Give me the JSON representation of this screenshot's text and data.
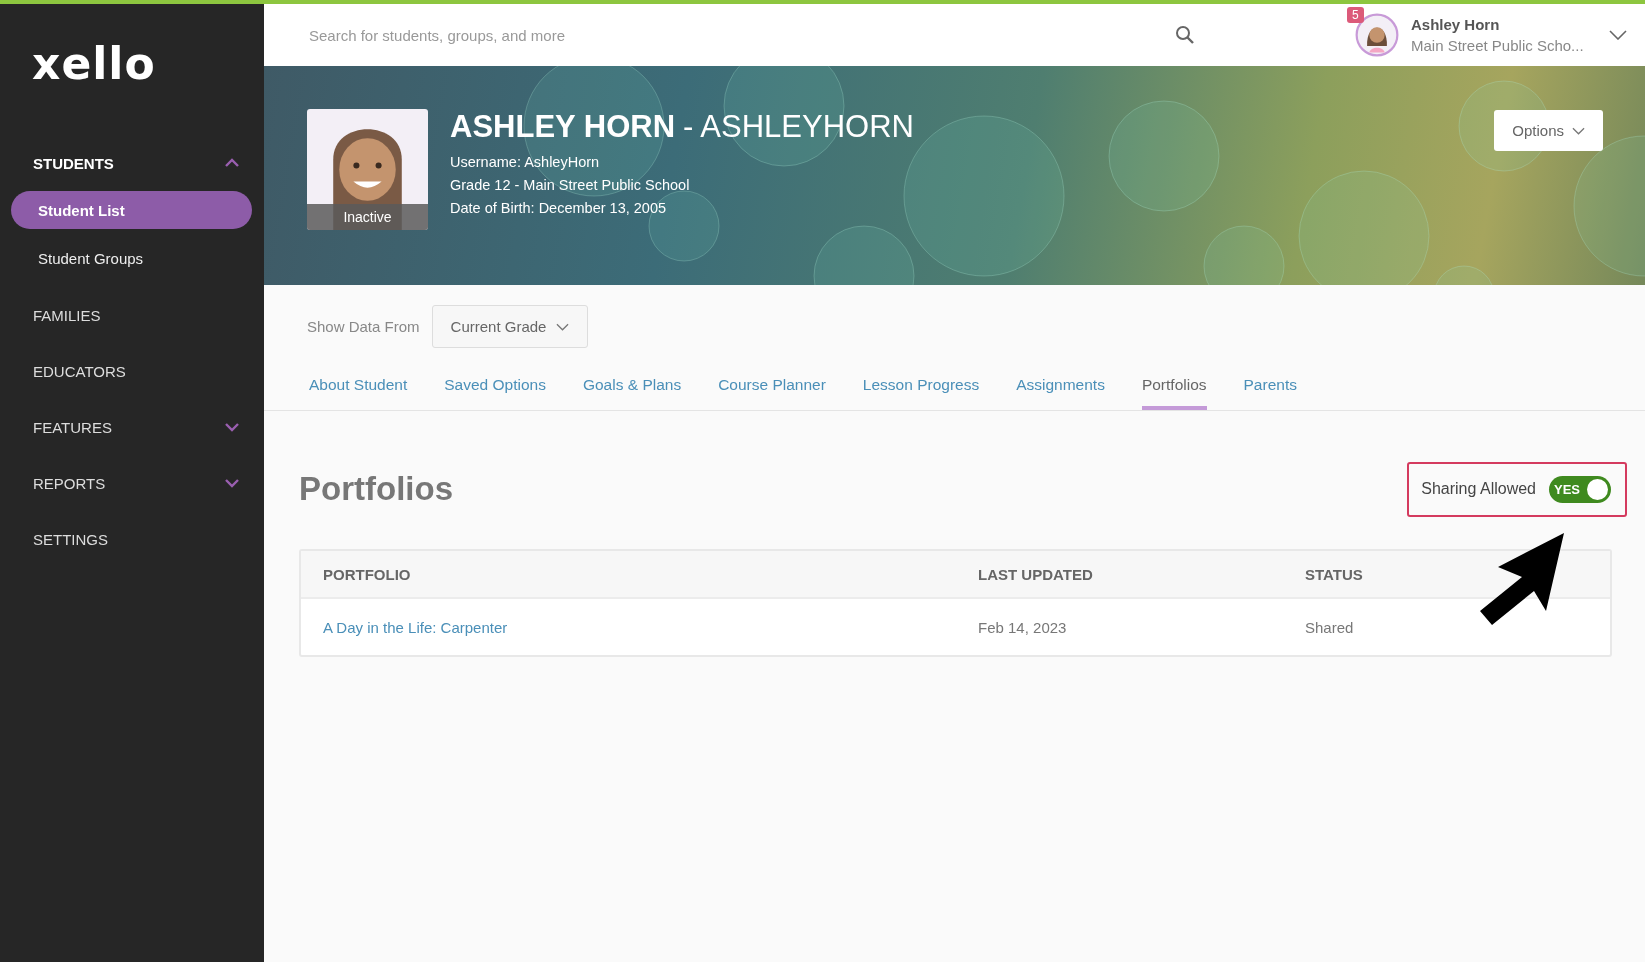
{
  "sidebar": {
    "logo": "xello",
    "items": [
      {
        "label": "STUDENTS",
        "expanded": true,
        "children": [
          {
            "label": "Student List",
            "selected": true
          },
          {
            "label": "Student Groups",
            "selected": false
          }
        ]
      },
      {
        "label": "FAMILIES"
      },
      {
        "label": "EDUCATORS"
      },
      {
        "label": "FEATURES",
        "expanded": false
      },
      {
        "label": "REPORTS",
        "expanded": false
      },
      {
        "label": "SETTINGS"
      }
    ]
  },
  "topbar": {
    "search": {
      "placeholder": "Search for students, groups, and more"
    },
    "notifications": "5",
    "user_name": "Ashley Horn",
    "user_school": "Main Street Public Scho..."
  },
  "profile": {
    "status": "Inactive",
    "name": "ASHLEY HORN",
    "username_caps": "- ASHLEYHORN",
    "details": [
      "Username: AshleyHorn",
      "Grade 12 - Main Street Public School",
      "Date of Birth: December 13, 2005"
    ],
    "options_button": "Options"
  },
  "filter": {
    "label": "Show Data From",
    "value": "Current Grade"
  },
  "tabs": [
    {
      "label": "About Student",
      "selected": false
    },
    {
      "label": "Saved Options",
      "selected": false
    },
    {
      "label": "Goals & Plans",
      "selected": false
    },
    {
      "label": "Course Planner",
      "selected": false
    },
    {
      "label": "Lesson Progress",
      "selected": false
    },
    {
      "label": "Assignments",
      "selected": false
    },
    {
      "label": "Portfolios",
      "selected": true
    },
    {
      "label": "Parents",
      "selected": false
    }
  ],
  "section": {
    "title": "Portfolios",
    "sharing": {
      "label": "Sharing Allowed",
      "on": true,
      "state_text": "YES"
    }
  },
  "table": {
    "columns": [
      "PORTFOLIO",
      "LAST UPDATED",
      "STATUS"
    ],
    "rows": [
      {
        "portfolio": "A Day in the Life: Carpenter",
        "last_updated": "Feb 14, 2023",
        "status": "Shared"
      }
    ]
  }
}
